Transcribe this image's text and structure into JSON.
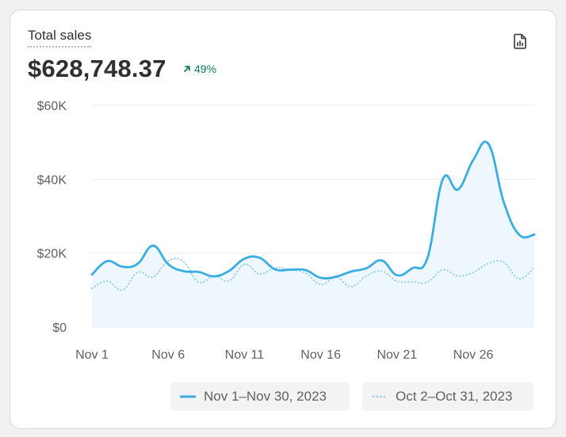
{
  "card": {
    "title": "Total sales",
    "value": "$628,748.37",
    "change": "49%",
    "export_icon": "chart-export-icon",
    "change_icon": "arrow-up-right-icon"
  },
  "colors": {
    "current": "#3aaee2",
    "previous": "#8fd0ee",
    "area": "#eef7fd",
    "grid": "#ebebeb",
    "positive": "#0c7c59",
    "axis_text": "#616161"
  },
  "legend": {
    "current": "Nov 1–Nov 30, 2023",
    "previous": "Oct 2–Oct 31, 2023"
  },
  "chart_data": {
    "type": "line",
    "x": [
      "Nov 1",
      "Nov 2",
      "Nov 3",
      "Nov 4",
      "Nov 5",
      "Nov 6",
      "Nov 7",
      "Nov 8",
      "Nov 9",
      "Nov 10",
      "Nov 11",
      "Nov 12",
      "Nov 13",
      "Nov 14",
      "Nov 15",
      "Nov 16",
      "Nov 17",
      "Nov 18",
      "Nov 19",
      "Nov 20",
      "Nov 21",
      "Nov 22",
      "Nov 23",
      "Nov 24",
      "Nov 25",
      "Nov 26",
      "Nov 27",
      "Nov 28",
      "Nov 29",
      "Nov 30"
    ],
    "x_ticks": [
      "Nov 1",
      "Nov 6",
      "Nov 11",
      "Nov 16",
      "Nov 21",
      "Nov 26"
    ],
    "x_tick_index": [
      0,
      5,
      10,
      15,
      20,
      25
    ],
    "y_ticks": [
      "$0",
      "$20K",
      "$40K",
      "$60K"
    ],
    "y_tick_values": [
      0,
      20000,
      40000,
      60000
    ],
    "ylim": [
      0,
      60000
    ],
    "grid": true,
    "legend_position": "bottom-right",
    "series": [
      {
        "name": "Nov 1–Nov 30, 2023",
        "style": "solid",
        "values": [
          14200,
          17800,
          16300,
          17100,
          22000,
          17000,
          15100,
          14900,
          13700,
          15200,
          18500,
          18700,
          15600,
          15500,
          15400,
          13300,
          13600,
          15000,
          15900,
          18000,
          14000,
          15900,
          18700,
          40000,
          37200,
          45200,
          49500,
          33800,
          25000,
          25000
        ]
      },
      {
        "name": "Oct 2–Oct 31, 2023",
        "style": "dotted",
        "values": [
          10500,
          12400,
          10000,
          14800,
          13500,
          17900,
          17700,
          12100,
          13800,
          12500,
          17000,
          14300,
          16000,
          15500,
          14600,
          11500,
          13400,
          10900,
          13800,
          15100,
          12400,
          12200,
          12100,
          15500,
          13800,
          14800,
          17200,
          17500,
          13000,
          16200
        ]
      }
    ]
  }
}
